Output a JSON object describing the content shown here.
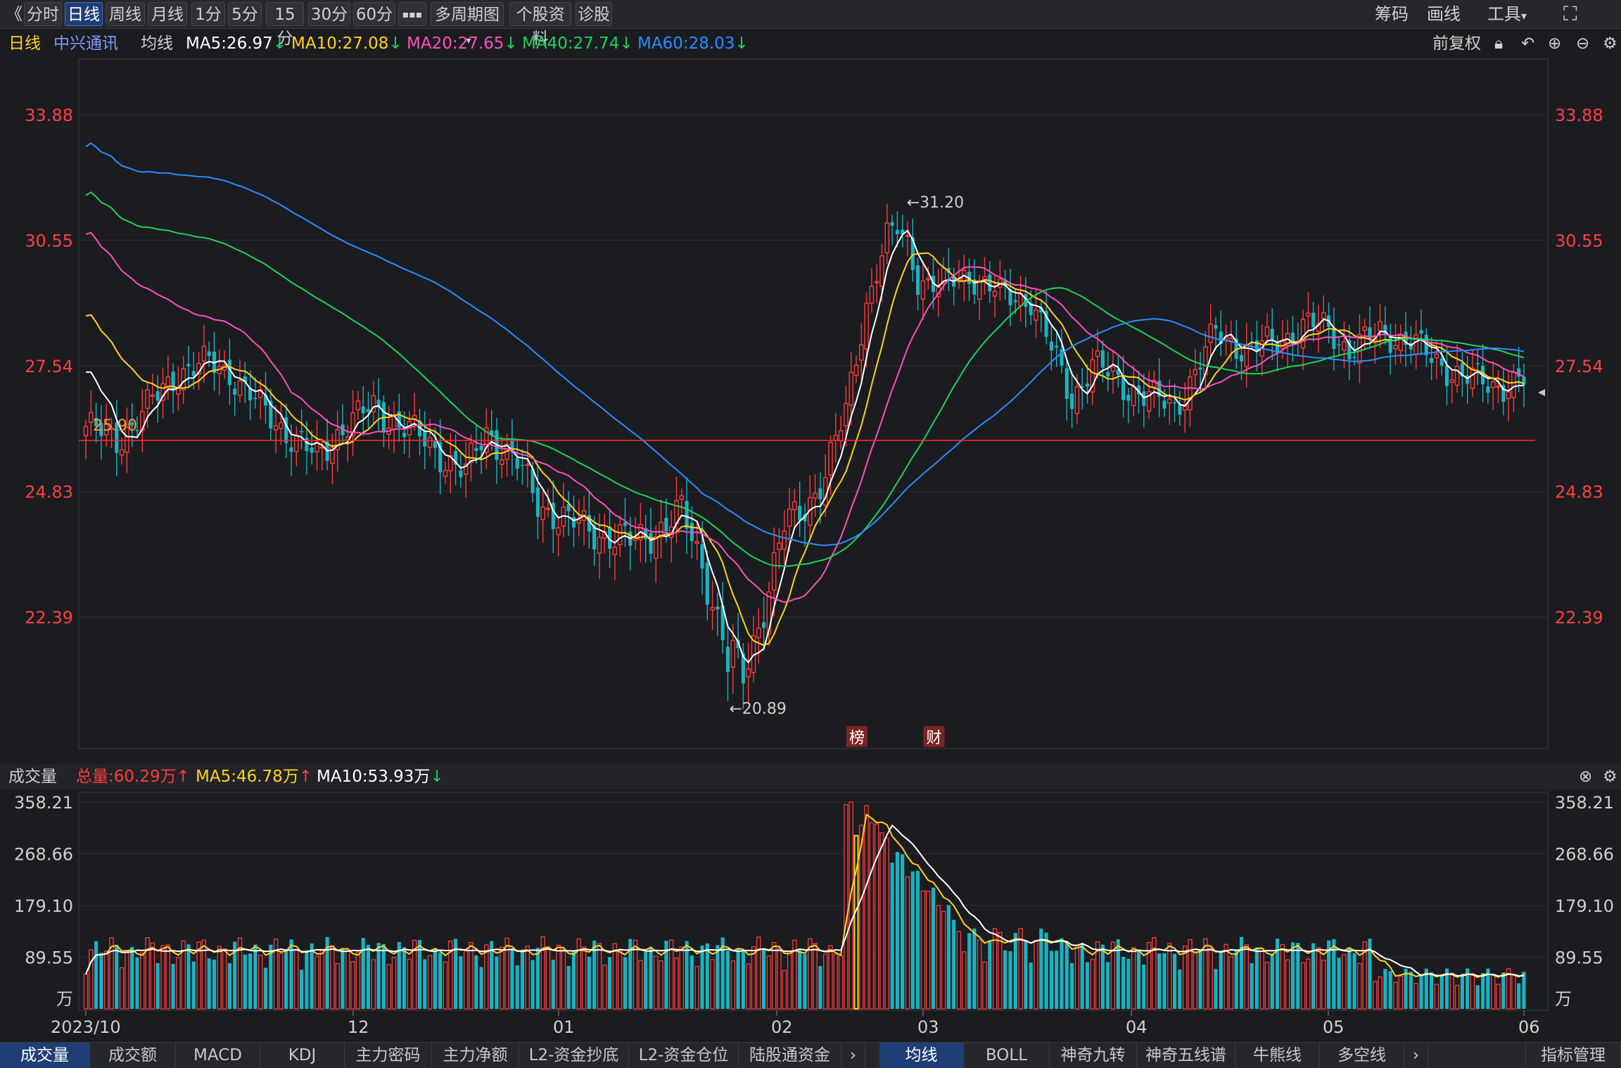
{
  "toolbar": {
    "back_glyph": "《",
    "periods": [
      "分时",
      "日线",
      "周线",
      "月线",
      "1分",
      "5分",
      "15分",
      "30分",
      "60分"
    ],
    "more_glyph": "▪▪▪",
    "multi": "多周期图",
    "profile": "个股资料",
    "diagnose": "诊股",
    "chips": "筹码",
    "draw": "画线",
    "tools": "工具",
    "fullscreen_glyph": "⛶"
  },
  "main_header": {
    "period": "日线",
    "stock": "中兴通讯",
    "ma_label": "均线",
    "ma5": "MA5:26.97",
    "ma10": "MA10:27.08",
    "ma20": "MA20:27.65",
    "ma40": "MA40:27.74",
    "ma60": "MA60:28.03",
    "adjust": "前复权"
  },
  "colors": {
    "up": "#ff3b3b",
    "down": "#1ab3c2",
    "ma5": "#ffffff",
    "ma10": "#ffd21f",
    "ma20": "#ff4fc0",
    "ma40": "#1fd15a",
    "ma60": "#2a8cff"
  },
  "price_axis": {
    "labels": [
      "33.88",
      "30.55",
      "27.54",
      "24.83",
      "22.39"
    ]
  },
  "annotations": {
    "high": "←31.20",
    "low": "←20.89",
    "ref_line": "25.90",
    "badge1": "榜",
    "badge2": "财"
  },
  "volume_header": {
    "title": "成交量",
    "total": "总量:60.29万",
    "ma5": "MA5:46.78万",
    "ma10": "MA10:53.93万"
  },
  "volume_axis": {
    "labels": [
      "358.21",
      "268.66",
      "179.10",
      "89.55"
    ],
    "unit": "万"
  },
  "date_axis": {
    "labels": [
      "2023/10",
      "12",
      "01",
      "02",
      "03",
      "04",
      "05",
      "06"
    ]
  },
  "bottom_tabs": {
    "left": [
      "成交量",
      "成交额",
      "MACD",
      "KDJ",
      "主力密码",
      "主力净额",
      "L2-资金抄底",
      "L2-资金仓位",
      "陆股通资金"
    ],
    "right": [
      "均线",
      "BOLL",
      "神奇九转",
      "神奇五线谱",
      "牛熊线",
      "多空线"
    ],
    "manage": "指标管理"
  },
  "chart_data": {
    "type": "candlestick",
    "ylim": [
      20.0,
      35.0
    ],
    "high": 31.2,
    "low": 20.89,
    "reference_line": 25.9,
    "ma_end_values": {
      "MA5": 26.97,
      "MA10": 27.08,
      "MA20": 27.65,
      "MA40": 27.74,
      "MA60": 28.03
    },
    "volume": {
      "unit": "万",
      "ylim": [
        0,
        358.21
      ],
      "total": 60.29
    }
  }
}
